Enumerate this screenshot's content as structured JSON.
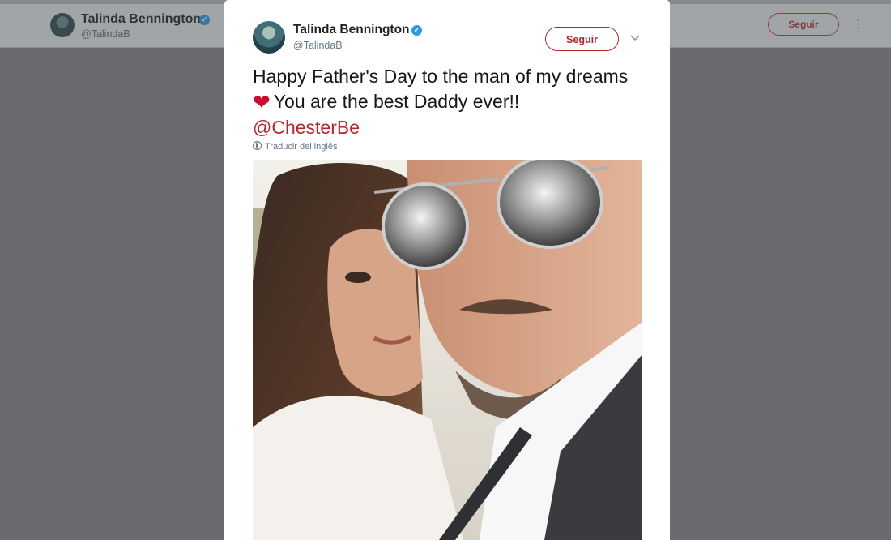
{
  "background_header": {
    "name": "Talinda Bennington",
    "handle": "@TalindaB",
    "follow_label": "Seguir",
    "more_icon": "⋮"
  },
  "tweet": {
    "author_name": "Talinda Bennington",
    "author_handle": "@TalindaB",
    "verified_glyph": "✓",
    "follow_label": "Seguir",
    "menu_icon": "chevron-down-icon",
    "text_line1": "Happy Father's Day to the man of my dreams",
    "heart_glyph": "❤",
    "text_line2": "You are the best Daddy ever!!",
    "mention": "@ChesterBe",
    "translate_label": "Traducir del inglés"
  },
  "colors": {
    "accent": "#b5262d",
    "verified": "#2b9be2",
    "heart": "#c8102e",
    "overlay_bg": "#838587"
  }
}
